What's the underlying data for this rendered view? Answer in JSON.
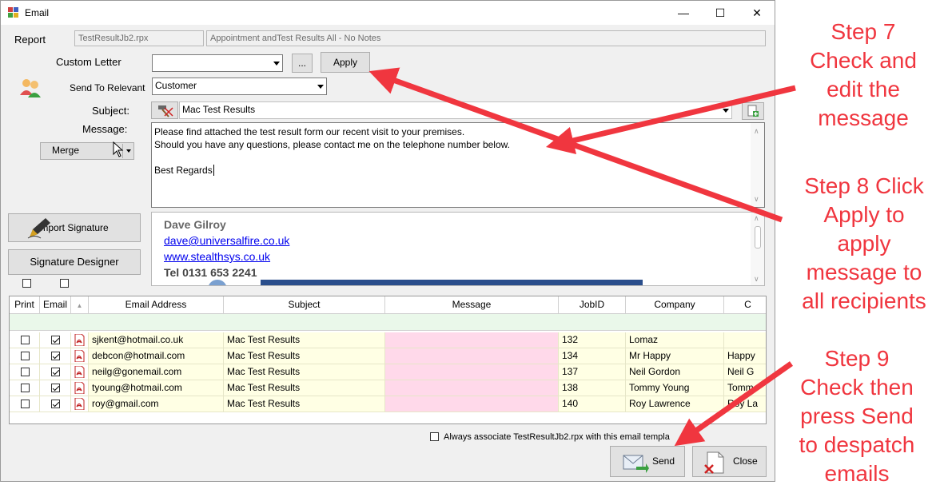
{
  "window": {
    "title": "Email"
  },
  "report": {
    "label": "Report",
    "file": "TestResultJb2.rpx",
    "description": "Appointment andTest Results All - No Notes"
  },
  "custom_letter": {
    "label": "Custom Letter",
    "value": "",
    "browse_label": "...",
    "apply_label": "Apply"
  },
  "send_to": {
    "label": "Send To Relevant",
    "value": "Customer"
  },
  "subject": {
    "label": "Subject:",
    "value": "Mac Test Results"
  },
  "message": {
    "label": "Message:",
    "merge_label": "Merge",
    "lines": [
      "Please find attached the test result form our recent visit to your premises.",
      "Should you have any questions, please contact me on the telephone number below.",
      "",
      "Best Regards"
    ]
  },
  "signature": {
    "import_label": "Import Signature",
    "designer_label": "Signature Designer",
    "name": "Dave Gilroy",
    "email": "dave@universalfire.co.uk",
    "website": "www.stealthsys.co.uk",
    "tel": "Tel 0131 653 2241"
  },
  "grid": {
    "columns": [
      "Print",
      "Email",
      "",
      "Email Address",
      "Subject",
      "Message",
      "JobID",
      "Company",
      "C"
    ],
    "rows": [
      {
        "print": false,
        "email": true,
        "address": "sjkent@hotmail.co.uk",
        "subject": "Mac Test Results",
        "message": "",
        "jobid": "132",
        "company": "Lomaz",
        "contact": ""
      },
      {
        "print": false,
        "email": true,
        "address": "debcon@hotmail.com",
        "subject": "Mac Test Results",
        "message": "",
        "jobid": "134",
        "company": "Mr Happy",
        "contact": "Happy"
      },
      {
        "print": false,
        "email": true,
        "address": "neilg@gonemail.com",
        "subject": "Mac Test Results",
        "message": "",
        "jobid": "137",
        "company": "Neil Gordon",
        "contact": "Neil G"
      },
      {
        "print": false,
        "email": true,
        "address": "tyoung@hotmail.com",
        "subject": "Mac Test Results",
        "message": "",
        "jobid": "138",
        "company": "Tommy Young",
        "contact": "Tomm"
      },
      {
        "print": false,
        "email": true,
        "address": "roy@gmail.com",
        "subject": "Mac Test Results",
        "message": "",
        "jobid": "140",
        "company": "Roy Lawrence",
        "contact": "Roy La"
      }
    ]
  },
  "associate": {
    "label": "Always associate TestResultJb2.rpx with this email templa"
  },
  "buttons": {
    "send_label": "Send",
    "close_label": "Close"
  },
  "annotations": {
    "step7": [
      "Step 7",
      "Check and",
      "edit the",
      "message"
    ],
    "step8": [
      "Step 8 Click",
      "Apply to",
      "apply",
      "message to",
      "all recipients"
    ],
    "step9": [
      "Step 9",
      "Check then",
      "press Send",
      "to despatch",
      "emails"
    ]
  },
  "colors": {
    "annotation": "#f0363f",
    "pink_cell": "#ffd9ea",
    "yellow_row": "#ffffe4",
    "filter_row": "#eaf8ea",
    "link": "#0000ee"
  }
}
